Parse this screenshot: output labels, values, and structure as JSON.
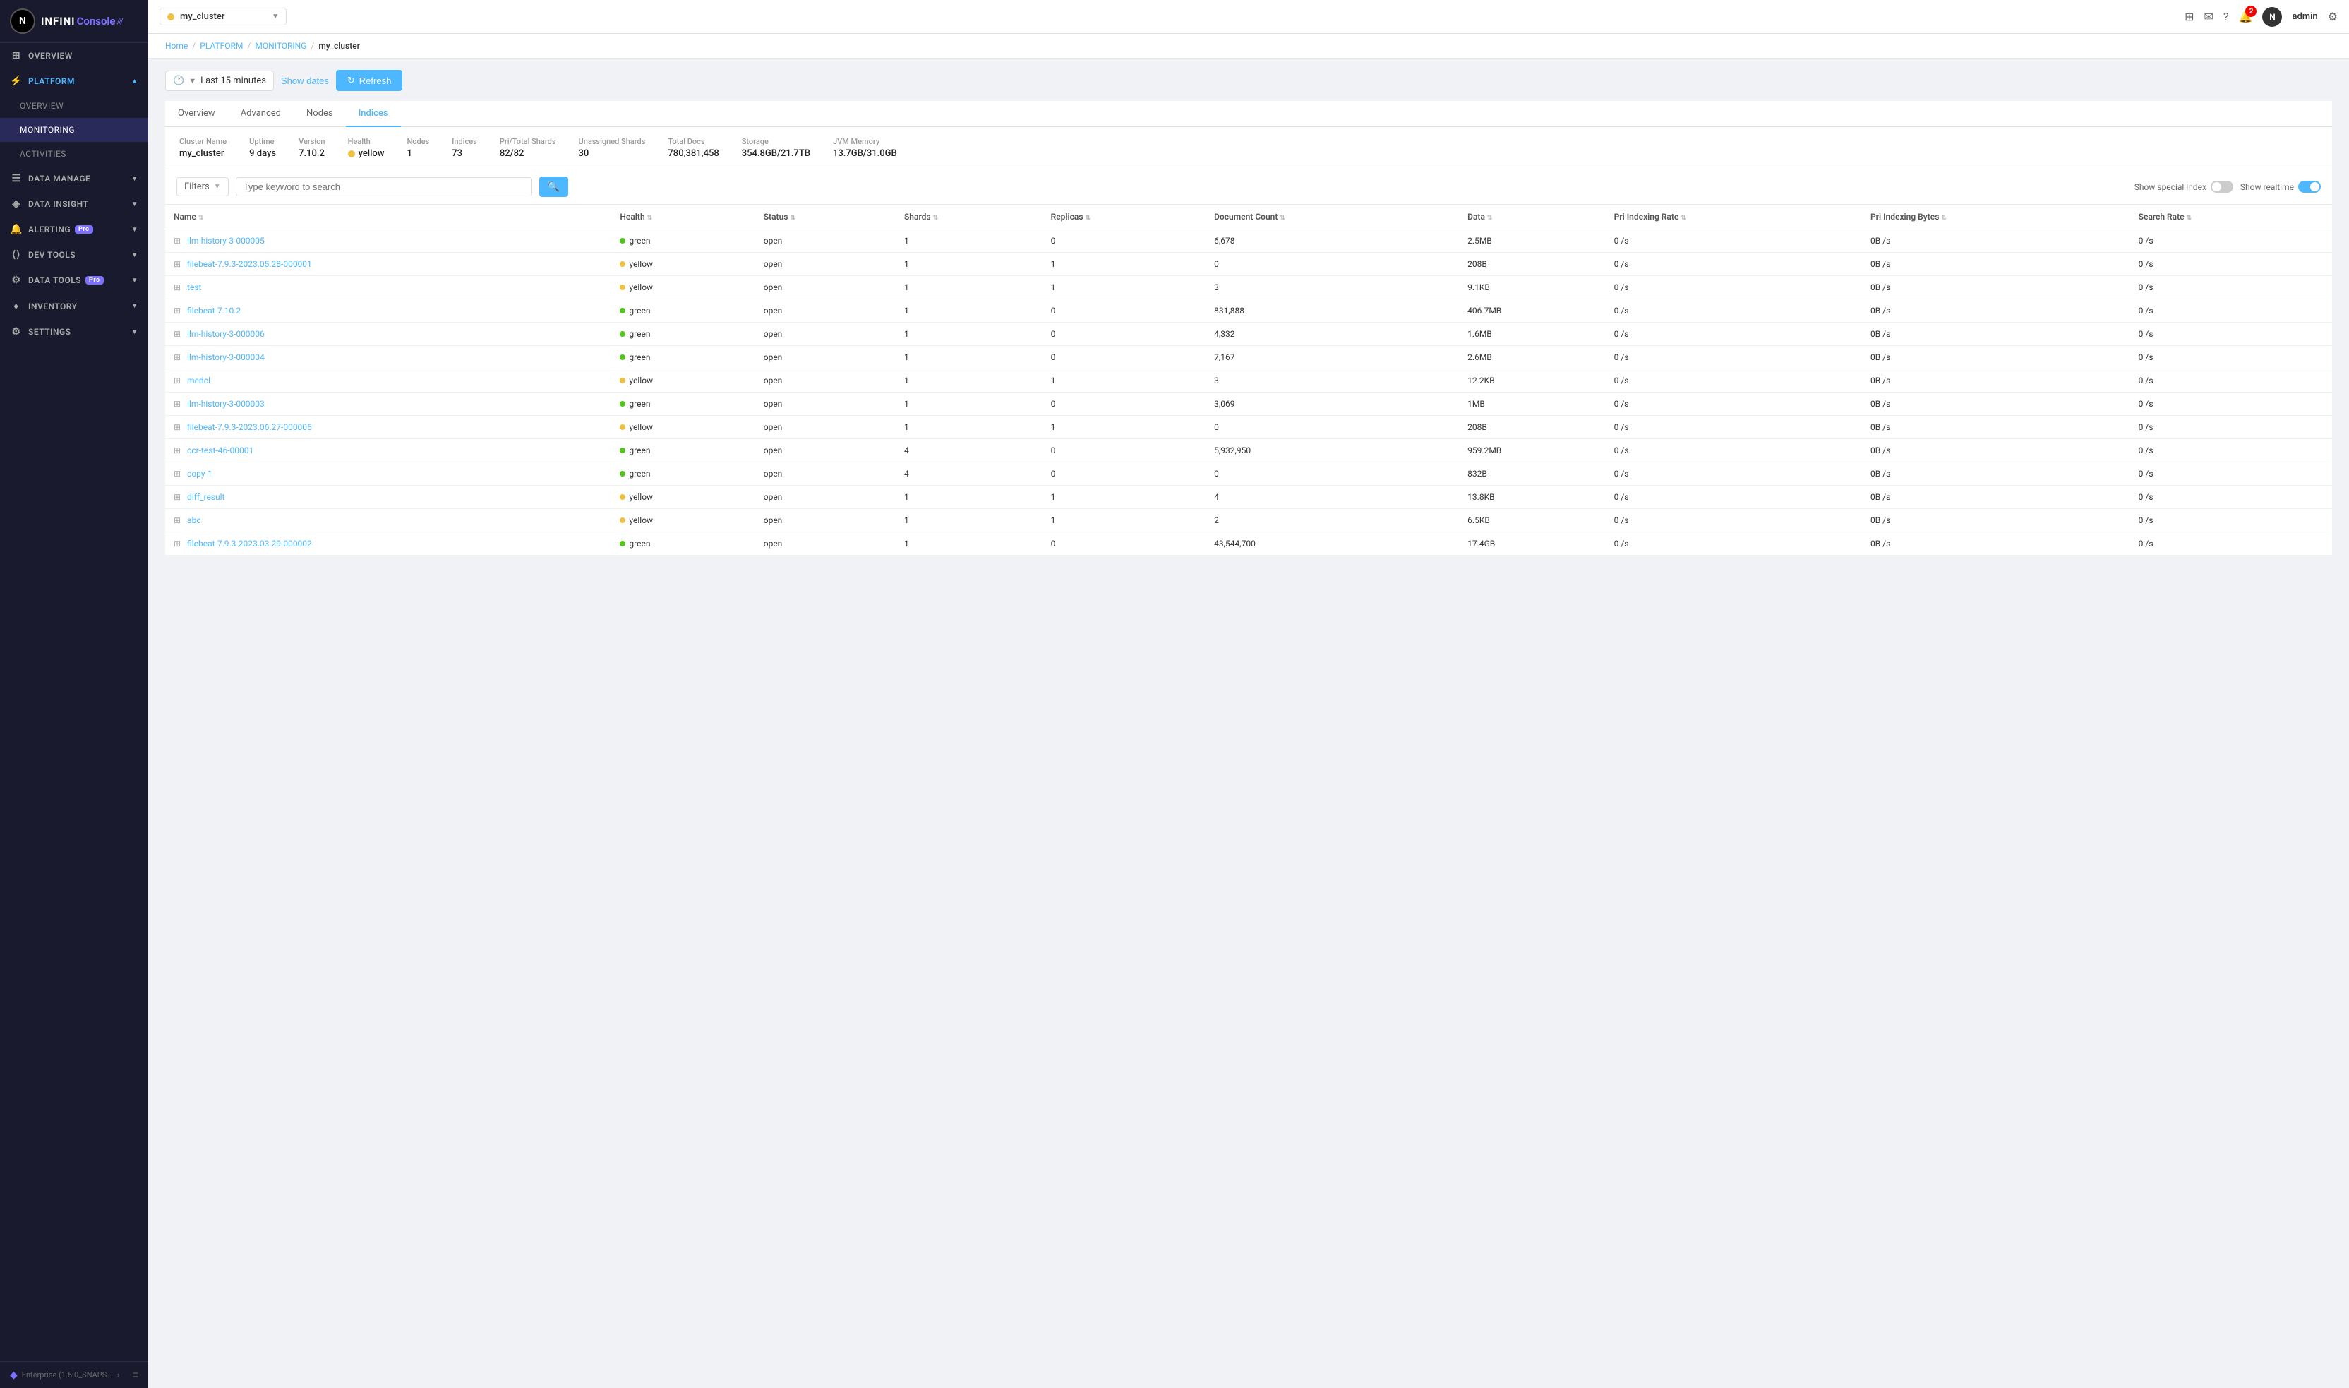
{
  "logo": {
    "initials": "N",
    "infini": "INFINI",
    "console": "Console",
    "bars": "///"
  },
  "sidebar": {
    "items": [
      {
        "id": "overview",
        "label": "OVERVIEW",
        "icon": "⊞",
        "active": false,
        "sub": false
      },
      {
        "id": "platform",
        "label": "PLATFORM",
        "icon": "⚡",
        "active": true,
        "sub": false,
        "hasArrow": true
      },
      {
        "id": "overview-sub",
        "label": "OVERVIEW",
        "icon": "",
        "active": false,
        "sub": true
      },
      {
        "id": "monitoring",
        "label": "MONITORING",
        "icon": "",
        "active": true,
        "sub": true
      },
      {
        "id": "activities",
        "label": "ACTIVITIES",
        "icon": "",
        "active": false,
        "sub": true
      },
      {
        "id": "data-manage",
        "label": "DATA MANAGE",
        "icon": "☰",
        "active": false,
        "sub": false,
        "hasArrow": true
      },
      {
        "id": "data-insight",
        "label": "DATA INSIGHT",
        "icon": "◈",
        "active": false,
        "sub": false,
        "hasArrow": true
      },
      {
        "id": "alerting",
        "label": "ALERTING",
        "icon": "🔔",
        "active": false,
        "sub": false,
        "hasArrow": true,
        "badge": "Pro"
      },
      {
        "id": "dev-tools",
        "label": "DEV TOOLS",
        "icon": "⟨⟩",
        "active": false,
        "sub": false,
        "hasArrow": true
      },
      {
        "id": "data-tools",
        "label": "DATA TOOLS",
        "icon": "⚙",
        "active": false,
        "sub": false,
        "hasArrow": true,
        "badge": "Pro"
      },
      {
        "id": "inventory",
        "label": "INVENTORY",
        "icon": "♦",
        "active": false,
        "sub": false,
        "hasArrow": true
      },
      {
        "id": "settings",
        "label": "SETTINGS",
        "icon": "⚙",
        "active": false,
        "sub": false,
        "hasArrow": true
      }
    ],
    "bottom_label": "Enterprise (1.5.0_SNAPS...",
    "bottom_arrow": "›"
  },
  "topbar": {
    "cluster_name": "my_cluster",
    "admin_label": "admin",
    "notif_count": "2"
  },
  "breadcrumb": {
    "home": "Home",
    "platform": "PLATFORM",
    "monitoring": "MONITORING",
    "current": "my_cluster"
  },
  "toolbar": {
    "time_label": "Last 15 minutes",
    "show_dates_label": "Show dates",
    "refresh_label": "Refresh"
  },
  "tabs": [
    {
      "id": "overview",
      "label": "Overview"
    },
    {
      "id": "advanced",
      "label": "Advanced"
    },
    {
      "id": "nodes",
      "label": "Nodes"
    },
    {
      "id": "indices",
      "label": "Indices",
      "active": true
    }
  ],
  "stats": {
    "cluster_name_label": "Cluster Name",
    "cluster_name_value": "my_cluster",
    "uptime_label": "Uptime",
    "uptime_value": "9 days",
    "version_label": "Version",
    "version_value": "7.10.2",
    "health_label": "Health",
    "health_value": "yellow",
    "nodes_label": "Nodes",
    "nodes_value": "1",
    "indices_label": "Indices",
    "indices_value": "73",
    "pri_shards_label": "Pri/Total Shards",
    "pri_shards_value": "82/82",
    "unassigned_label": "Unassigned Shards",
    "unassigned_value": "30",
    "total_docs_label": "Total Docs",
    "total_docs_value": "780,381,458",
    "storage_label": "Storage",
    "storage_value": "354.8GB/21.7TB",
    "jvm_label": "JVM Memory",
    "jvm_value": "13.7GB/31.0GB"
  },
  "filters": {
    "placeholder": "Type keyword to search",
    "filters_label": "Filters",
    "show_special_label": "Show special index",
    "show_realtime_label": "Show realtime"
  },
  "table": {
    "columns": [
      {
        "id": "name",
        "label": "Name"
      },
      {
        "id": "health",
        "label": "Health"
      },
      {
        "id": "status",
        "label": "Status"
      },
      {
        "id": "shards",
        "label": "Shards"
      },
      {
        "id": "replicas",
        "label": "Replicas"
      },
      {
        "id": "doc_count",
        "label": "Document Count"
      },
      {
        "id": "data",
        "label": "Data"
      },
      {
        "id": "pri_indexing_rate",
        "label": "Pri Indexing Rate"
      },
      {
        "id": "pri_indexing_bytes",
        "label": "Pri Indexing Bytes"
      },
      {
        "id": "search_rate",
        "label": "Search Rate"
      }
    ],
    "rows": [
      {
        "name": "ilm-history-3-000005",
        "health": "green",
        "status": "open",
        "shards": "1",
        "replicas": "0",
        "doc_count": "6,678",
        "data": "2.5MB",
        "pri_rate": "0 /s",
        "pri_bytes": "0B /s",
        "search_rate": "0 /s"
      },
      {
        "name": "filebeat-7.9.3-2023.05.28-000001",
        "health": "yellow",
        "status": "open",
        "shards": "1",
        "replicas": "1",
        "doc_count": "0",
        "data": "208B",
        "pri_rate": "0 /s",
        "pri_bytes": "0B /s",
        "search_rate": "0 /s"
      },
      {
        "name": "test",
        "health": "yellow",
        "status": "open",
        "shards": "1",
        "replicas": "1",
        "doc_count": "3",
        "data": "9.1KB",
        "pri_rate": "0 /s",
        "pri_bytes": "0B /s",
        "search_rate": "0 /s"
      },
      {
        "name": "filebeat-7.10.2",
        "health": "green",
        "status": "open",
        "shards": "1",
        "replicas": "0",
        "doc_count": "831,888",
        "data": "406.7MB",
        "pri_rate": "0 /s",
        "pri_bytes": "0B /s",
        "search_rate": "0 /s"
      },
      {
        "name": "ilm-history-3-000006",
        "health": "green",
        "status": "open",
        "shards": "1",
        "replicas": "0",
        "doc_count": "4,332",
        "data": "1.6MB",
        "pri_rate": "0 /s",
        "pri_bytes": "0B /s",
        "search_rate": "0 /s"
      },
      {
        "name": "ilm-history-3-000004",
        "health": "green",
        "status": "open",
        "shards": "1",
        "replicas": "0",
        "doc_count": "7,167",
        "data": "2.6MB",
        "pri_rate": "0 /s",
        "pri_bytes": "0B /s",
        "search_rate": "0 /s"
      },
      {
        "name": "medcl",
        "health": "yellow",
        "status": "open",
        "shards": "1",
        "replicas": "1",
        "doc_count": "3",
        "data": "12.2KB",
        "pri_rate": "0 /s",
        "pri_bytes": "0B /s",
        "search_rate": "0 /s"
      },
      {
        "name": "ilm-history-3-000003",
        "health": "green",
        "status": "open",
        "shards": "1",
        "replicas": "0",
        "doc_count": "3,069",
        "data": "1MB",
        "pri_rate": "0 /s",
        "pri_bytes": "0B /s",
        "search_rate": "0 /s"
      },
      {
        "name": "filebeat-7.9.3-2023.06.27-000005",
        "health": "yellow",
        "status": "open",
        "shards": "1",
        "replicas": "1",
        "doc_count": "0",
        "data": "208B",
        "pri_rate": "0 /s",
        "pri_bytes": "0B /s",
        "search_rate": "0 /s"
      },
      {
        "name": "ccr-test-46-00001",
        "health": "green",
        "status": "open",
        "shards": "4",
        "replicas": "0",
        "doc_count": "5,932,950",
        "data": "959.2MB",
        "pri_rate": "0 /s",
        "pri_bytes": "0B /s",
        "search_rate": "0 /s"
      },
      {
        "name": "copy-1",
        "health": "green",
        "status": "open",
        "shards": "4",
        "replicas": "0",
        "doc_count": "0",
        "data": "832B",
        "pri_rate": "0 /s",
        "pri_bytes": "0B /s",
        "search_rate": "0 /s"
      },
      {
        "name": "diff_result",
        "health": "yellow",
        "status": "open",
        "shards": "1",
        "replicas": "1",
        "doc_count": "4",
        "data": "13.8KB",
        "pri_rate": "0 /s",
        "pri_bytes": "0B /s",
        "search_rate": "0 /s"
      },
      {
        "name": "abc",
        "health": "yellow",
        "status": "open",
        "shards": "1",
        "replicas": "1",
        "doc_count": "2",
        "data": "6.5KB",
        "pri_rate": "0 /s",
        "pri_bytes": "0B /s",
        "search_rate": "0 /s"
      },
      {
        "name": "filebeat-7.9.3-2023.03.29-000002",
        "health": "green",
        "status": "open",
        "shards": "1",
        "replicas": "0",
        "doc_count": "43,544,700",
        "data": "17.4GB",
        "pri_rate": "0 /s",
        "pri_bytes": "0B /s",
        "search_rate": "0 /s"
      }
    ]
  },
  "colors": {
    "accent": "#4db8ff",
    "sidebar_bg": "#1a1a2e",
    "yellow": "#f0c040",
    "green": "#52c41a"
  }
}
